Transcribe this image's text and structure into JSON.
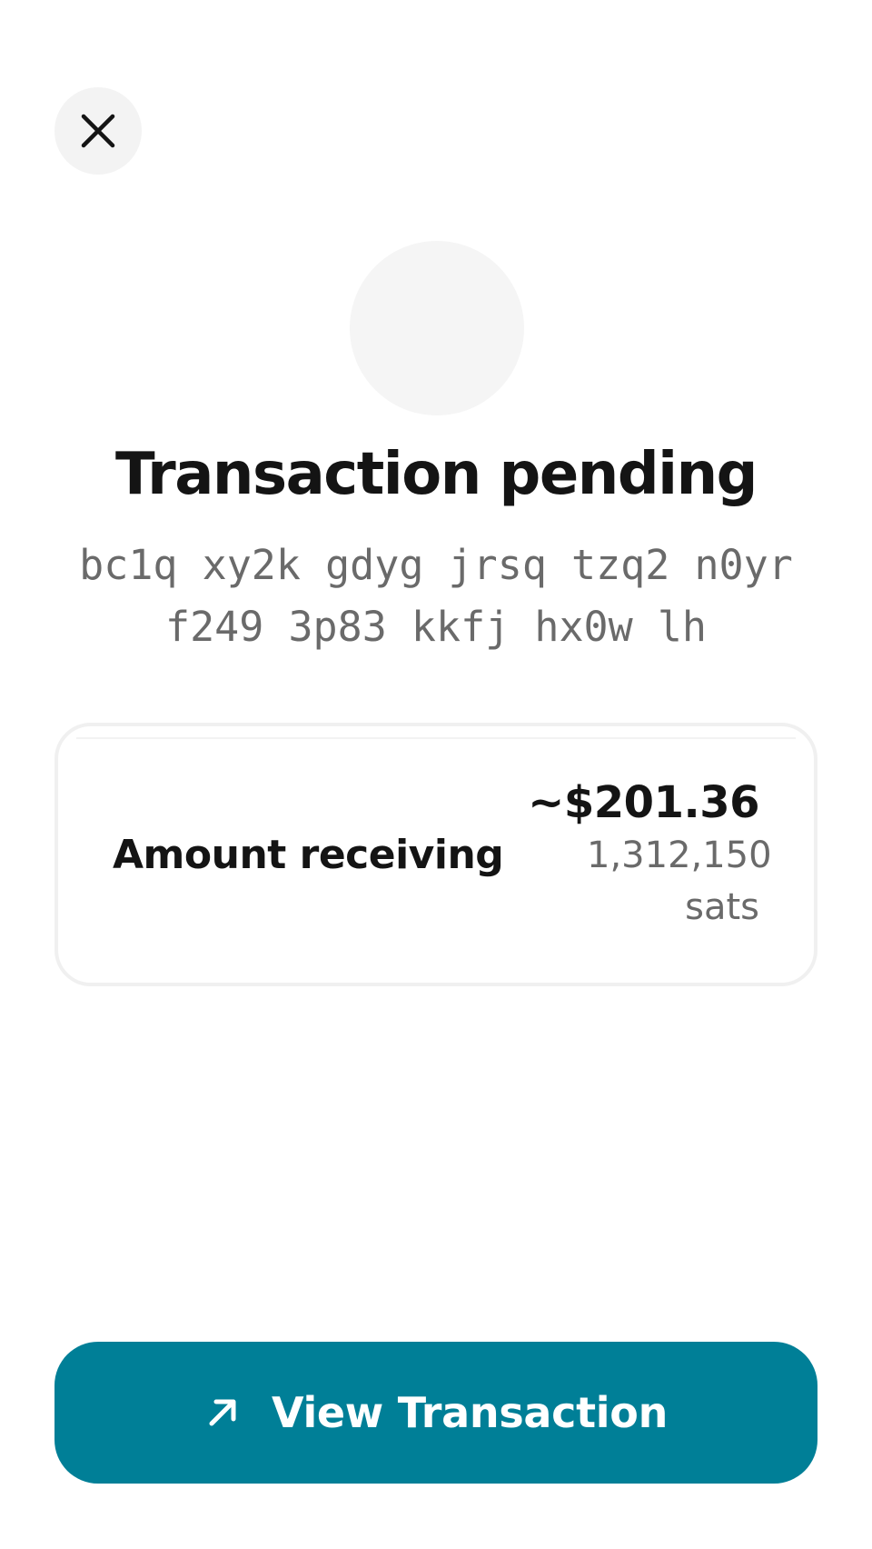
{
  "header": {
    "close_icon": "close-icon"
  },
  "status": {
    "title": "Transaction pending"
  },
  "address": {
    "line1": "bc1q xy2k gdyg jrsq tzq2 n0yr",
    "line2": "f249 3p83 kkfj hx0w lh"
  },
  "amount_card": {
    "label": "Amount receiving",
    "fiat_value": "~$201.36",
    "sats_value": "1,312,150 sats"
  },
  "actions": {
    "view_transaction_label": "View Transaction",
    "view_transaction_icon": "arrow-up-right-icon"
  },
  "colors": {
    "accent": "#007f97",
    "muted_text": "#6a6a6a",
    "surface": "#f3f3f3"
  }
}
